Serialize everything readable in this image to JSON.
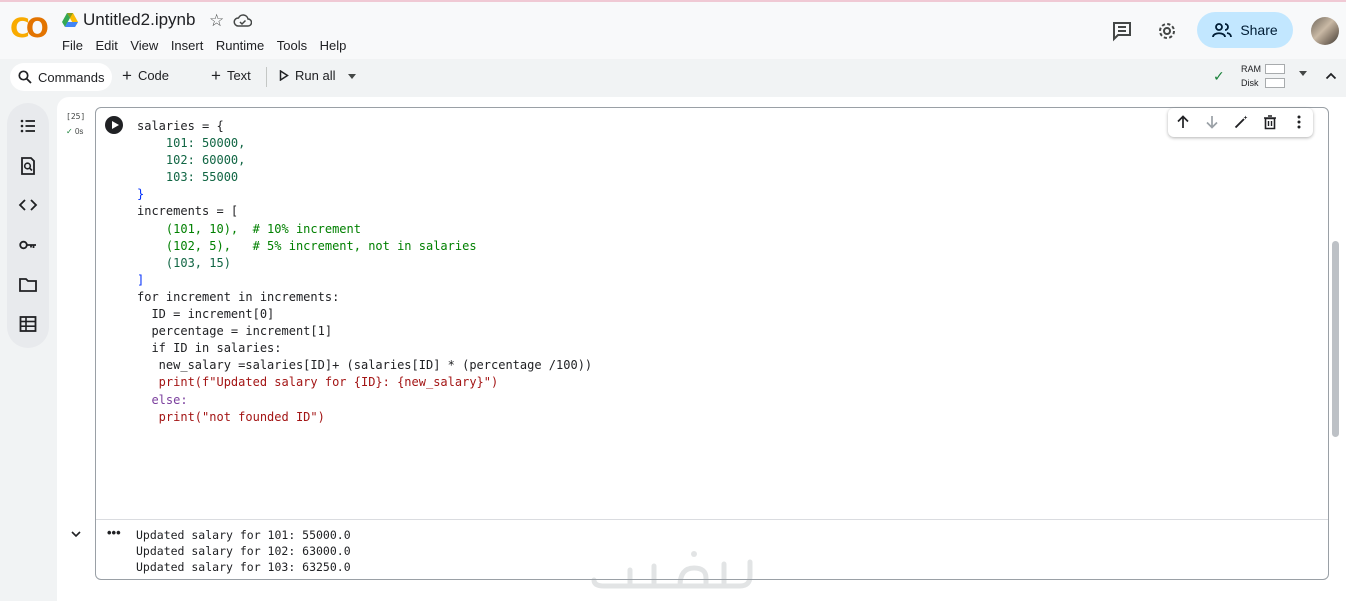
{
  "app": {
    "logo": "CO",
    "notebook_title": "Untitled2.ipynb",
    "menu": [
      "File",
      "Edit",
      "View",
      "Insert",
      "Runtime",
      "Tools",
      "Help"
    ],
    "share_label": "Share"
  },
  "toolbar": {
    "commands_label": "Commands",
    "code_label": "Code",
    "text_label": "Text",
    "run_all_label": "Run all",
    "ram_label": "RAM",
    "disk_label": "Disk"
  },
  "cell": {
    "execution_count": "[25]",
    "execution_time": "0s",
    "code_lines": [
      "salaries = {",
      "    101: 50000,",
      "    102: 60000,",
      "    103: 55000",
      "}",
      "increments = [",
      "    (101, 10),  # 10% increment",
      "    (102, 5),   # 5% increment, not in salaries",
      "    (103, 15)",
      "]",
      "for increment in increments:",
      "  ID = increment[0]",
      "  percentage = increment[1]",
      "  if ID in salaries:",
      "   new_salary =salaries[ID]+ (salaries[ID] * (percentage /100))",
      "   print(f\"Updated salary for {ID}: {new_salary}\")",
      "  else:",
      "   print(\"not founded ID\")"
    ],
    "output_lines": [
      "Updated salary for 101: 55000.0",
      "Updated salary for 102: 63000.0",
      "Updated salary for 103: 63250.0"
    ],
    "output_menu": "•••"
  },
  "colors": {
    "share_bg": "#c2e7ff",
    "success": "#188038",
    "keyword": "#7a3e9d",
    "number": "#116644",
    "string": "#a31515",
    "comment": "#008000"
  },
  "icons": {
    "header": [
      "drive-icon",
      "star-icon",
      "cloud-saved-icon",
      "comment-icon",
      "settings-icon",
      "share-people-icon",
      "user-avatar"
    ],
    "rail": [
      "table-of-contents-icon",
      "find-replace-icon",
      "code-snippets-icon",
      "secrets-key-icon",
      "files-folder-icon",
      "variables-table-icon"
    ],
    "cell_toolbar": [
      "move-up-icon",
      "move-down-icon",
      "edit-wand-icon",
      "delete-icon",
      "more-vert-icon"
    ]
  }
}
